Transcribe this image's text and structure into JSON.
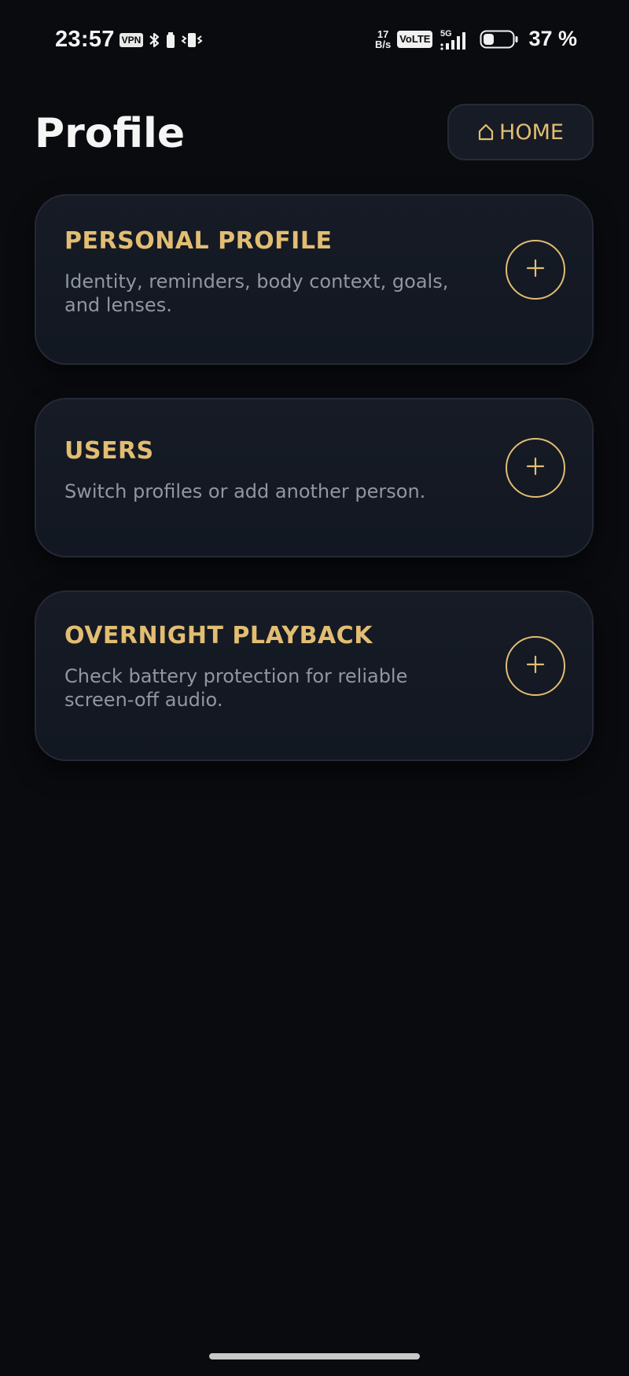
{
  "status_bar": {
    "time": "23:57",
    "vpn_label": "VPN",
    "net_speed_value": "17",
    "net_speed_unit": "B/s",
    "volte_label": "VoLTE",
    "network_type": "5G",
    "battery_percent": "37 %",
    "icons": [
      "bluetooth-icon",
      "vibrate-icon",
      "signal-icon",
      "battery-icon"
    ]
  },
  "header": {
    "title": "Profile",
    "home_button_label": "HOME",
    "home_icon": "home-icon"
  },
  "cards": [
    {
      "title": "PERSONAL PROFILE",
      "description": "Identity, reminders, body context, goals, and lenses.",
      "action_icon": "plus-icon"
    },
    {
      "title": "USERS",
      "description": "Switch profiles or add another person.",
      "action_icon": "plus-icon"
    },
    {
      "title": "OVERNIGHT PLAYBACK",
      "description": "Check battery protection for reliable screen-off audio.",
      "action_icon": "plus-icon"
    }
  ],
  "colors": {
    "background": "#0a0b0f",
    "card_background": "#141924",
    "accent_gold": "#e2bd72",
    "description_gray": "#9097a3"
  }
}
